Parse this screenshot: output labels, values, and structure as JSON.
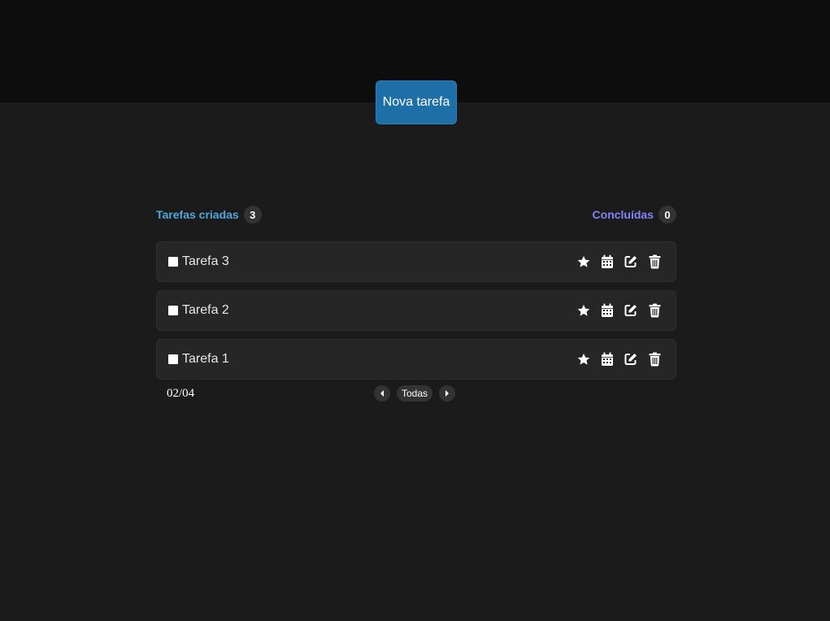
{
  "header": {
    "new_task_label": "Nova tarefa"
  },
  "counters": {
    "created_label": "Tarefas criadas",
    "created_count": "3",
    "done_label": "Concluídas",
    "done_count": "0"
  },
  "tasks": [
    {
      "title": "Tarefa 3",
      "done": false
    },
    {
      "title": "Tarefa 2",
      "done": false
    },
    {
      "title": "Tarefa 1",
      "done": false
    }
  ],
  "footer": {
    "date": "02/04",
    "filter_label": "Todas"
  },
  "icons": {
    "favorite": "star-icon",
    "schedule": "calendar-icon",
    "edit": "edit-icon",
    "delete": "trash-icon",
    "prev": "caret-left-icon",
    "next": "caret-right-icon"
  },
  "colors": {
    "accent_blue": "#1e6fa8",
    "created_label": "#4ea8de",
    "done_label": "#8284fa"
  }
}
